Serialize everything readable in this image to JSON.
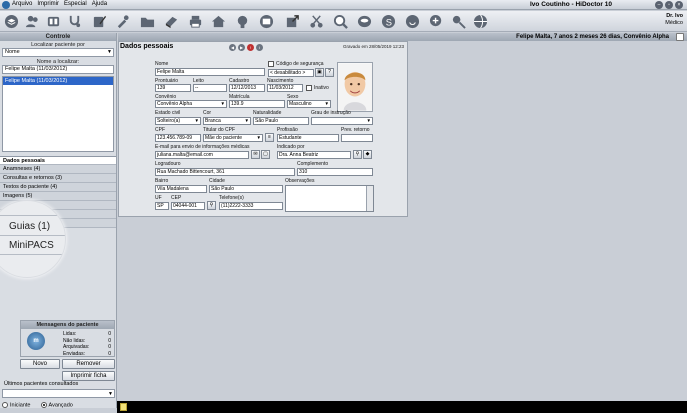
{
  "menu": {
    "items": [
      "Arquivo",
      "Imprimir",
      "Especial",
      "Ajuda"
    ]
  },
  "window": {
    "title": "Ivo Coutinho - HiDoctor 10"
  },
  "user": {
    "name": "Dr. Ivo",
    "role": "Médico"
  },
  "left": {
    "header": "Controle",
    "search_by_label": "Localizar paciente por",
    "search_by_value": "Nome",
    "name_label": "Nome a localizar:",
    "name_value": "Felipe Malta (11/03/2012)",
    "list": [
      "Felipe Malta (11/03/2012)"
    ],
    "tabs": [
      "Dados pessoais",
      "Anamneses  (4)",
      "Consultas e retornos  (3)",
      "Textos do paciente  (4)",
      "Imagens  (5)"
    ],
    "magnifier_items": [
      "Guias  (1)",
      "MiniPACS"
    ],
    "messages": {
      "header": "Mensagens do paciente",
      "rows": [
        {
          "label": "Lidas:",
          "value": "0"
        },
        {
          "label": "Não lidas:",
          "value": "0"
        },
        {
          "label": "Arquivadas:",
          "value": "0"
        },
        {
          "label": "Enviadas:",
          "value": "0"
        }
      ]
    },
    "new_button": "Novo",
    "remove_button": "Remover",
    "print_button": "Imprimir ficha",
    "recent_label": "Últimos pacientes consultados",
    "mode_basic": "Iniciante",
    "mode_adv": "Avançado"
  },
  "main": {
    "patient_header": "Felipe Malta, 7 anos 2 meses 26 dias, Convênio Alpha",
    "form_title": "Dados pessoais",
    "saved": "Gravado em 28/05/2019 12:23",
    "fields": {
      "nome_l": "Nome",
      "nome": "Felipe Malta",
      "cod_l": "Código de segurança",
      "cod_sel": "< desabilitado >",
      "pront_l": "Prontuário",
      "pront": "139",
      "leito_l": "Leito",
      "leito": "--",
      "cad_l": "Cadastro",
      "cad": "12/12/2013",
      "nasc_l": "Nascimento",
      "nasc": "11/03/2012",
      "inativo_l": "Inativo",
      "conv_l": "Convênio",
      "conv": "Convênio Alpha",
      "matr_l": "Matrícula",
      "matr": "139.9",
      "sexo_l": "Sexo",
      "sexo": "Masculino",
      "civil_l": "Estado civil",
      "civil": "Solteiro(a)",
      "cor_l": "Cor",
      "cor": "Branca",
      "nat_l": "Naturalidade",
      "nat": "São Paulo",
      "grau_l": "Grau de instrução",
      "cpf_l": "CPF",
      "cpf": "123.456.789-09",
      "tit_l": "Titular do CPF",
      "tit": "Mãe do paciente",
      "prof_l": "Profissão",
      "prof": "Estudante",
      "prev_l": "Prev. retorno",
      "email_l": "E-mail para envio de informações médicas",
      "email": "juliana.malta@email.com",
      "ind_l": "Indicado por",
      "ind": "Dra. Anna Beatriz",
      "logr_l": "Logradouro",
      "logr": "Rua Machado Bittencourt, 361",
      "compl_l": "Complemento",
      "compl": "310",
      "bairro_l": "Bairro",
      "bairro": "Vila Madalena",
      "cidade_l": "Cidade",
      "cidade": "São Paulo",
      "obs_l": "Observações",
      "uf_l": "UF",
      "uf": "SP",
      "cep_l": "CEP",
      "cep": "04044-001",
      "tel_l": "Telefone(s)",
      "tel": "(11)2222-3333"
    }
  }
}
